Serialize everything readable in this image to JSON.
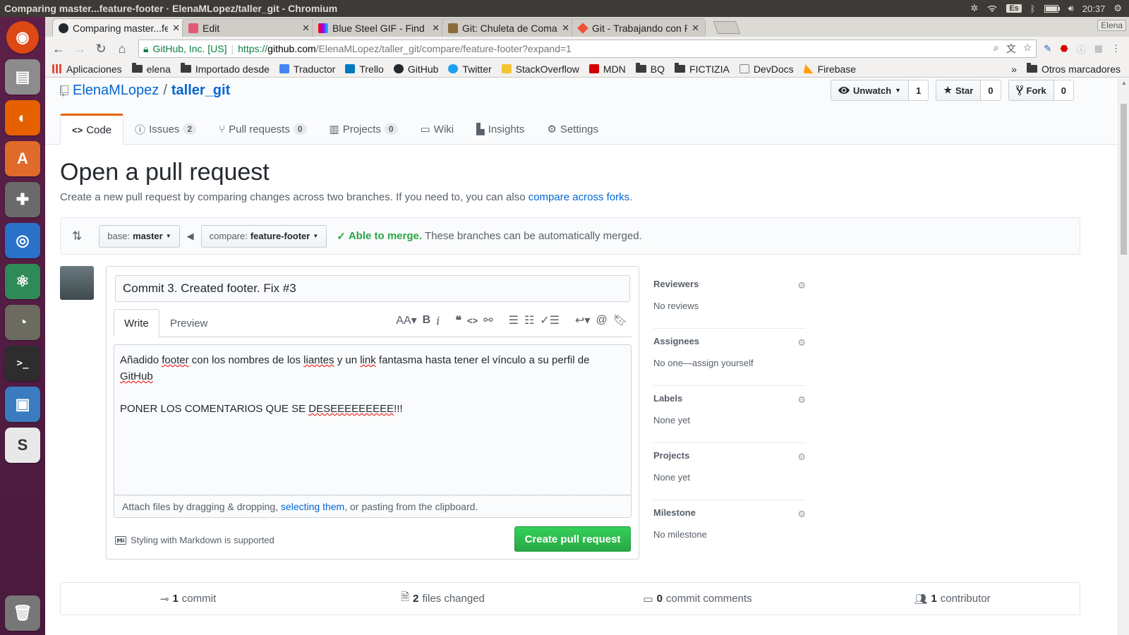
{
  "window_title": "Comparing master...feature-footer · ElenaMLopez/taller_git - Chromium",
  "system": {
    "keyboard": "Es",
    "clock": "20:37"
  },
  "tabs": [
    {
      "title": "Comparing master...feature-footer · ElenaMLopez/taller_git",
      "active": true,
      "icon": "github-icon"
    },
    {
      "title": "Edit",
      "active": false,
      "icon": "slides-icon"
    },
    {
      "title": "Blue Steel GIF - Find & Share on GIPHY",
      "active": false,
      "icon": "giphy-icon"
    },
    {
      "title": "Git: Chuleta de Comandos",
      "active": false,
      "icon": "film-icon"
    },
    {
      "title": "Git - Trabajando con Ramas",
      "active": false,
      "icon": "git-icon"
    }
  ],
  "user_button": "Elena",
  "address": {
    "security": "GitHub, Inc. [US]",
    "scheme": "https://",
    "host": "github.com",
    "path": "/ElenaMLopez/taller_git/compare/feature-footer?expand=1"
  },
  "bookmarks": [
    {
      "label": "Aplicaciones",
      "icon": "apps-icon",
      "color": "#e04b3a"
    },
    {
      "label": "elena",
      "icon": "folder-icon"
    },
    {
      "label": "Importado desde",
      "icon": "folder-icon"
    },
    {
      "label": "Traductor",
      "icon": "translate-icon",
      "color": "#4285f4"
    },
    {
      "label": "Trello",
      "icon": "trello-icon",
      "color": "#0079bf"
    },
    {
      "label": "GitHub",
      "icon": "github-icon",
      "color": "#24292e"
    },
    {
      "label": "Twitter",
      "icon": "twitter-icon",
      "color": "#1da1f2"
    },
    {
      "label": "StackOverflow",
      "icon": "stackoverflow-icon",
      "color": "#f4c430"
    },
    {
      "label": "MDN",
      "icon": "mdn-icon",
      "color": "#d40000"
    },
    {
      "label": "BQ",
      "icon": "folder-icon"
    },
    {
      "label": "FICTIZIA",
      "icon": "folder-icon"
    },
    {
      "label": "DevDocs",
      "icon": "devdocs-icon",
      "color": "#888888"
    },
    {
      "label": "Firebase",
      "icon": "firebase-icon",
      "color": "#ffa000"
    }
  ],
  "bookmarks_overflow": "»",
  "other_bookmarks": "Otros marcadores",
  "repo": {
    "owner": "ElenaMLopez",
    "separator": "/",
    "name": "taller_git"
  },
  "actions": {
    "watch": {
      "label": "Unwatch",
      "count": "1"
    },
    "star": {
      "label": "Star",
      "count": "0"
    },
    "fork": {
      "label": "Fork",
      "count": "0"
    }
  },
  "reponav": [
    {
      "label": "Code",
      "icon": "code-icon",
      "selected": true,
      "count": ""
    },
    {
      "label": "Issues",
      "icon": "issue-icon",
      "selected": false,
      "count": "2"
    },
    {
      "label": "Pull requests",
      "icon": "pull-request-icon",
      "selected": false,
      "count": "0"
    },
    {
      "label": "Projects",
      "icon": "project-icon",
      "selected": false,
      "count": "0"
    },
    {
      "label": "Wiki",
      "icon": "book-icon",
      "selected": false,
      "count": ""
    },
    {
      "label": "Insights",
      "icon": "graph-icon",
      "selected": false,
      "count": ""
    },
    {
      "label": "Settings",
      "icon": "gear-icon",
      "selected": false,
      "count": ""
    }
  ],
  "compare": {
    "title": "Open a pull request",
    "description": "Create a new pull request by comparing changes across two branches. If you need to, you can also ",
    "link": "compare across forks",
    "period": ".",
    "base_prefix": "base: ",
    "base_branch": "master",
    "compare_prefix": "compare: ",
    "compare_branch": "feature-footer",
    "merge_status": "Able to merge.",
    "merge_message": "These branches can be automatically merged."
  },
  "form": {
    "title_value": "Commit 3. Created footer. Fix #3",
    "write_tab": "Write",
    "preview_tab": "Preview",
    "body_line1_a": "Añadido ",
    "body_w_footer": "footer",
    "body_line1_b": " con los nombres de los ",
    "body_w_liantes": "liantes",
    "body_line1_c": " y un ",
    "body_w_link": "link",
    "body_line1_d": " fantasma hasta tener el vínculo a su perfil de",
    "body_w_github": "GitHub",
    "body_line3_a": "PONER LOS COMENTARIOS QUE SE ",
    "body_w_dese": "DESEEEEEEEEE",
    "body_line3_b": "!!!",
    "attach_a": "Attach files by dragging & dropping, ",
    "attach_link": "selecting them",
    "attach_b": ", or pasting from the clipboard.",
    "markdown_note": "Styling with Markdown is supported",
    "submit": "Create pull request"
  },
  "sidebar": [
    {
      "heading": "Reviewers",
      "value": "No reviews"
    },
    {
      "heading": "Assignees",
      "value": "No one—assign yourself"
    },
    {
      "heading": "Labels",
      "value": "None yet"
    },
    {
      "heading": "Projects",
      "value": "None yet"
    },
    {
      "heading": "Milestone",
      "value": "No milestone"
    }
  ],
  "summary": [
    {
      "count": "1",
      "label": "commit",
      "icon": "commit-icon"
    },
    {
      "count": "2",
      "label": "files changed",
      "icon": "file-diff-icon"
    },
    {
      "count": "0",
      "label": "commit comments",
      "icon": "comment-icon"
    },
    {
      "count": "1",
      "label": "contributor",
      "icon": "people-icon"
    }
  ],
  "colors": {
    "link": "#0366d6",
    "merge_ok": "#28a745",
    "tab_accent": "#e36209",
    "launcher": "#5d2049"
  }
}
